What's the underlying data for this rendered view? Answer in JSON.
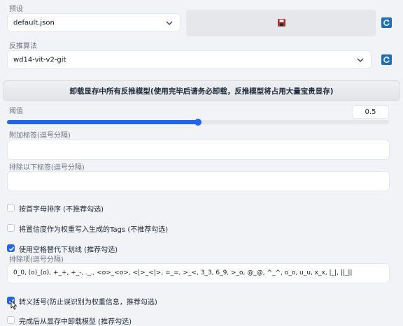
{
  "preset": {
    "label": "预设",
    "value": "default.json",
    "save_icon": "save-icon",
    "refresh_icon": "refresh-icon"
  },
  "interrogator": {
    "label": "反推算法",
    "value": "wd14-vit-v2-git",
    "refresh_icon": "refresh-icon"
  },
  "unload_button": "卸载显存中所有反推模型(使用完毕后请务必卸载，反推模型将占用大量宝贵显存)",
  "threshold": {
    "label": "阈值",
    "value": "0.5",
    "fraction": 0.5
  },
  "additional_tags": {
    "label": "附加标签(逗号分隔)",
    "value": ""
  },
  "exclude_tags": {
    "label": "排除以下标签(逗号分隔)",
    "value": ""
  },
  "options": {
    "sort_alpha": {
      "label": "按首字母排序 (不推荐勾选)",
      "checked": false
    },
    "confidence_weight": {
      "label": "将置信度作为权重写入生成的Tags (不推荐勾选)",
      "checked": false
    },
    "space_underscore": {
      "label": "使用空格替代下划线 (推荐勾选)",
      "checked": true
    },
    "escape_brackets": {
      "label": "转义括号(防止误识别为权重信息，推荐勾选)",
      "checked": true
    },
    "unload_after": {
      "label": "完成后从显存中卸载模型 (推荐勾选)",
      "checked": false
    }
  },
  "exclude_items": {
    "label": "排除项(逗号分隔)",
    "value": "0_0, (o)_(o), +_+, +_-, ._., <o>_<o>, <|>_<|>, =_=, >_<, 3_3, 6_9, >_o, @_@, ^_^, o_o, u_u, x_x, |_|, ||_||"
  },
  "colors": {
    "accent": "#2563eb",
    "refresh": "#1e6fb8",
    "save": "#c62828"
  }
}
